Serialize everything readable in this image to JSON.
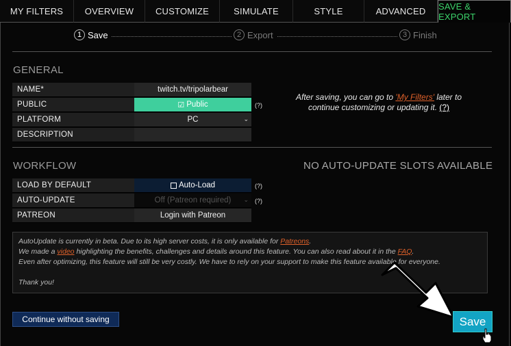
{
  "tabs": [
    {
      "label": "MY FILTERS"
    },
    {
      "label": "OVERVIEW"
    },
    {
      "label": "CUSTOMIZE"
    },
    {
      "label": "SIMULATE"
    },
    {
      "label": "STYLE"
    },
    {
      "label": "ADVANCED"
    },
    {
      "label": "SAVE & EXPORT",
      "active": true
    }
  ],
  "steps": {
    "s1": {
      "num": "1",
      "label": "Save"
    },
    "s2": {
      "num": "2",
      "label": "Export"
    },
    "s3": {
      "num": "3",
      "label": "Finish"
    }
  },
  "general": {
    "title": "GENERAL",
    "name_label": "NAME*",
    "name_value": "twitch.tv/tripolarbear",
    "public_label": "PUBLIC",
    "public_value": "Public",
    "public_check": "☑",
    "platform_label": "PLATFORM",
    "platform_value": "PC",
    "description_label": "DESCRIPTION",
    "description_value": "",
    "help": "(?)"
  },
  "side_info": {
    "text1": "After saving, you can go to ",
    "link": "'My Filters'",
    "text2": " later to continue customizing or updating it. ",
    "q": "(?)"
  },
  "workflow": {
    "title": "WORKFLOW",
    "right_title": "NO AUTO-UPDATE SLOTS AVAILABLE",
    "load_label": "LOAD BY DEFAULT",
    "load_value": "Auto-Load",
    "autoupdate_label": "AUTO-UPDATE",
    "autoupdate_value": "Off (Patreon required)",
    "patreon_label": "PATREON",
    "patreon_value": "Login with Patreon",
    "help": "(?)"
  },
  "note": {
    "l1a": "AutoUpdate is currently in beta. Due to its high server costs, it is only available for ",
    "l1link": "Patreons",
    "l1b": ".",
    "l2a": "We made a ",
    "l2link": "video",
    "l2b": " highlighting the benefits, challenges and details around this feature. You can also read about it in the ",
    "l2link2": "FAQ",
    "l2c": ".",
    "l3": "Even after optimizing, this feature will still be very costly. We have to rely on your support to make this feature available for everyone.",
    "l4": "Thank you!"
  },
  "buttons": {
    "continue": "Continue without saving",
    "save": "Save"
  },
  "colors": {
    "accent_green": "#3cd26a",
    "public_green": "#3fcf9d",
    "link_orange": "#e0612a",
    "save_blue": "#13a4c4",
    "continue_navy": "#0f2a57"
  }
}
